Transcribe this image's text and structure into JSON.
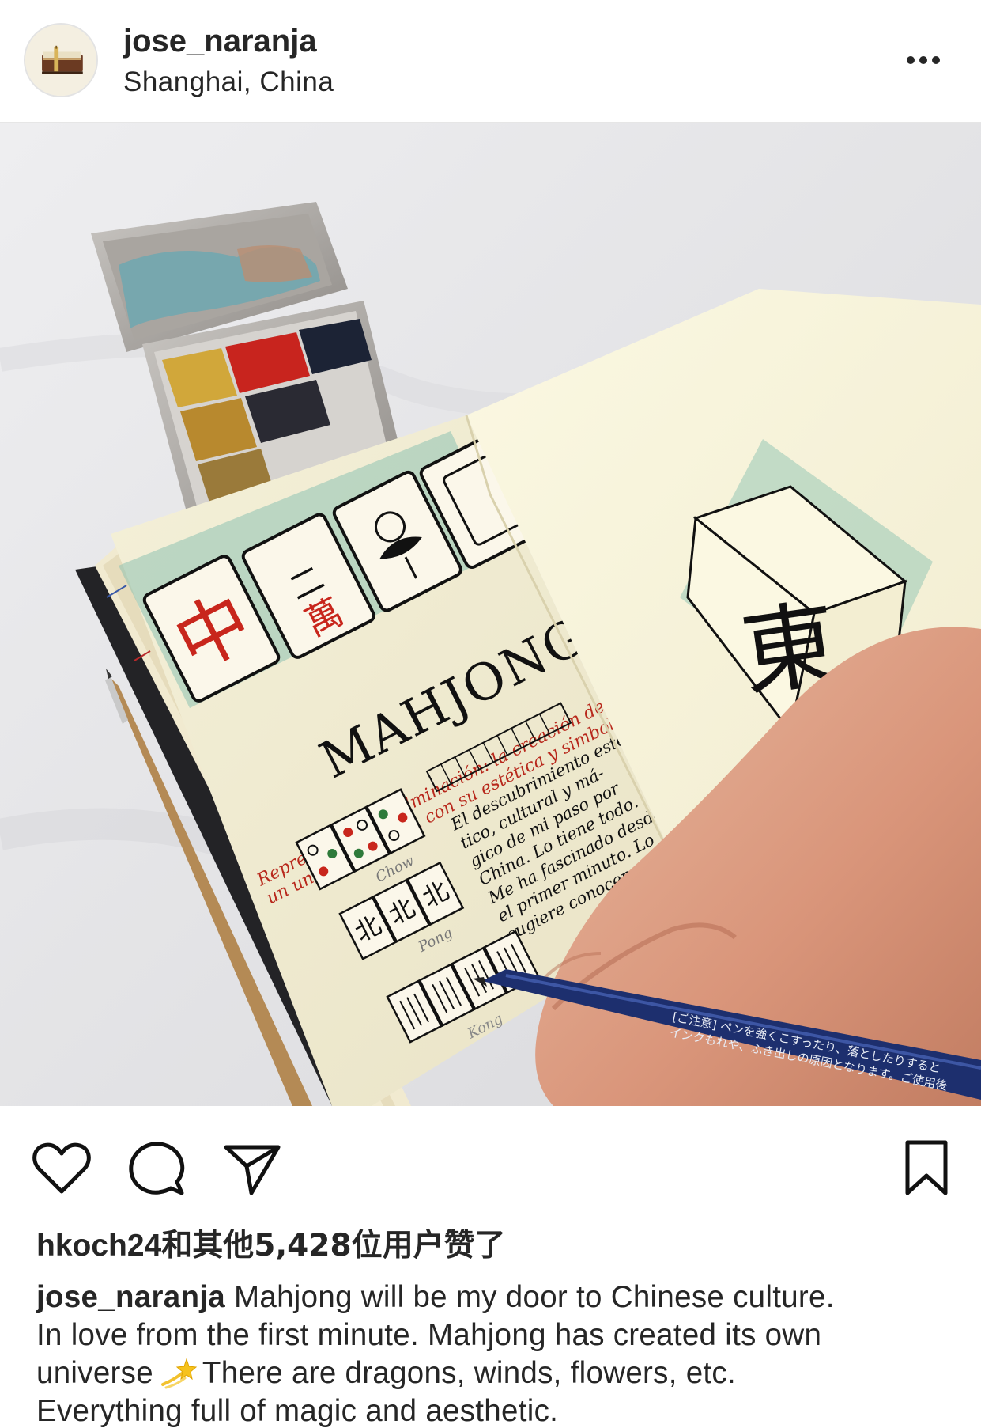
{
  "header": {
    "username": "jose_naranja",
    "location": "Shanghai, China",
    "avatar_icon": "notebook-avatar-icon",
    "more_icon": "more-options-icon"
  },
  "photo": {
    "alt_subject": "sketchbook with mahjong illustrations",
    "left_page": {
      "tiles": [
        "中",
        "二萬"
      ],
      "title": "MAHJONG",
      "subtitle_line_1": "Representa una culminación: la creación de",
      "subtitle_line_2": "un universo propio, con su estética y simbología",
      "paragraph": [
        "El descubrimiento esté-",
        "tico, cultural y má-",
        "gico de mi paso por",
        "China. Lo tiene todo.",
        "Me ha fascinado desde",
        "el primer minuto. Lo",
        "sugiere conocer,"
      ],
      "labels": [
        "Chow",
        "Pong",
        "Kong"
      ],
      "wind_tiles": [
        "北",
        "北",
        "北"
      ]
    },
    "right_page": {
      "tile_char": "東"
    },
    "pen_text": [
      "[ご注意] ペンを強くこすったり、落としたりすると",
      "インクもれや、ふき出しの原因となります。ご使用後"
    ]
  },
  "actions": {
    "like_icon": "heart-icon",
    "comment_icon": "comment-bubble-icon",
    "share_icon": "paper-plane-icon",
    "save_icon": "bookmark-icon"
  },
  "likes": {
    "liker": "hkoch24",
    "text": "和其他5,428位用户赞了"
  },
  "caption": {
    "username": "jose_naranja",
    "line_1": "Mahjong will be my door to Chinese culture.",
    "line_2": "In love from the first minute. Mahjong has created its own",
    "line_3_before": "universe",
    "line_3_emoji": "dizzy-star-emoji",
    "line_3_after": "There are dragons, winds, flowers, etc.",
    "line_4": "Everything full of magic and aesthetic."
  },
  "colors": {
    "text": "#262626",
    "divider": "#e6e6e6",
    "tile_red": "#c8261c",
    "watercolor_teal": "#7fb9a8",
    "pen_blue": "#1d2f6e"
  }
}
